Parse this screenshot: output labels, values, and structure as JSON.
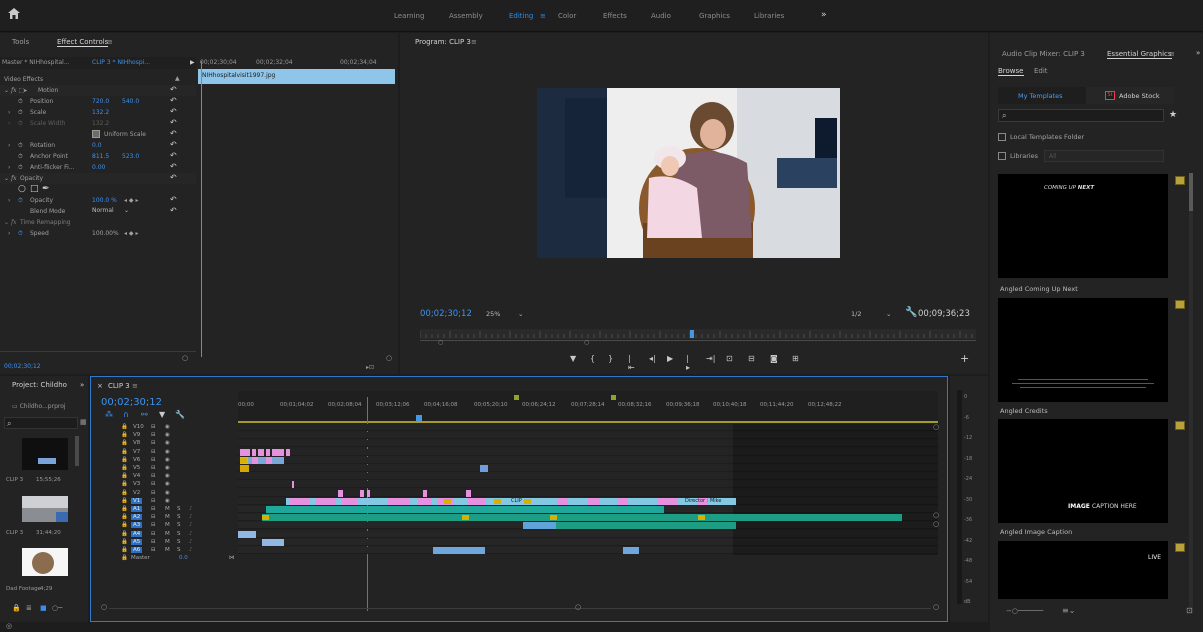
{
  "workspaces": [
    "Learning",
    "Assembly",
    "Editing",
    "Color",
    "Effects",
    "Audio",
    "Graphics",
    "Libraries"
  ],
  "workspace_menu_glyph": "≡",
  "more_glyph": "»",
  "effect_controls": {
    "tab_tools": "Tools",
    "tab_effect_controls": "Effect Controls",
    "menu_glyph": "≡",
    "master_label": "Master * NIHhospital...",
    "clip_label": "CLIP 3 * NIHhospi...",
    "time_a": "00;02;30;04",
    "time_b": "00;02;32;04",
    "time_c": "00;02;34;04",
    "clip_file": "NIHhospitalvisit1997.jpg",
    "video_effects": "Video Effects",
    "motion": "Motion",
    "position_label": "Position",
    "position_x": "720.0",
    "position_y": "540.0",
    "scale_label": "Scale",
    "scale_value": "132.2",
    "scale_width_label": "Scale Width",
    "scale_width_value": "132.2",
    "uniform_scale": "Uniform Scale",
    "rotation_label": "Rotation",
    "rotation_value": "0.0",
    "anchor_label": "Anchor Point",
    "anchor_x": "811.5",
    "anchor_y": "523.0",
    "antiflicker_label": "Anti-flicker Fi...",
    "antiflicker_value": "0.00",
    "opacity_group": "Opacity",
    "opacity_label": "Opacity",
    "opacity_value": "100.0 %",
    "blend_label": "Blend Mode",
    "blend_value": "Normal",
    "time_remap": "Time Remapping",
    "speed_label": "Speed",
    "speed_value": "100.00%",
    "current_time": "00;02;30;12"
  },
  "program": {
    "title": "Program: CLIP 3",
    "menu_glyph": "≡",
    "timecode": "00;02;30;12",
    "zoom": "25%",
    "resolution": "1/2",
    "duration": "00;09;36;23"
  },
  "essential_graphics": {
    "tab_audio_mixer": "Audio Clip Mixer: CLIP 3",
    "tab_essential": "Essential Graphics",
    "menu_glyph": "≡",
    "more_glyph": "»",
    "browse": "Browse",
    "edit": "Edit",
    "my_templates": "My Templates",
    "adobe_stock": "Adobe Stock",
    "stock_badge": "St",
    "local_templates": "Local Templates Folder",
    "libraries": "Libraries",
    "libraries_select": "All",
    "templates": [
      {
        "label": "Angled Coming Up Next",
        "preview_a": "COMING UP ",
        "preview_b": "NEXT"
      },
      {
        "label": "Angled Credits",
        "preview_a": "",
        "preview_b": ""
      },
      {
        "label": "Angled Image Caption",
        "preview_a": "IMAGE ",
        "preview_b": "CAPTION HERE"
      },
      {
        "label": "",
        "preview_a": "LIVE",
        "preview_b": ""
      }
    ]
  },
  "project": {
    "title": "Project: Childho",
    "more_glyph": "»",
    "file": "Childho...prproj",
    "items": [
      {
        "name": "CLIP 3",
        "duration": "15;55;26"
      },
      {
        "name": "CLIP 3",
        "duration": "31;44;20"
      },
      {
        "name": "Dad Footage",
        "duration": "4;29"
      }
    ]
  },
  "timeline": {
    "tab": "CLIP 3",
    "menu_glyph": "≡",
    "timecode": "00;02;30;12",
    "ruler": [
      "00;00",
      "00;01;04;02",
      "00;02;08;04",
      "00;03;12;06",
      "00;04;16;08",
      "00;05;20;10",
      "00;06;24;12",
      "00;07;28;14",
      "00;08;32;16",
      "00;09;36;18",
      "00;10;40;18",
      "00;11;44;20",
      "00;12;48;22"
    ],
    "video_tracks": [
      "V10",
      "V9",
      "V8",
      "V7",
      "V6",
      "V5",
      "V4",
      "V3",
      "V2",
      "V1"
    ],
    "audio_tracks": [
      "A1",
      "A2",
      "A3",
      "A4",
      "A5",
      "A6"
    ],
    "master_label": "Master",
    "master_value": "0.0",
    "clip_labels": [
      "CLIP",
      "Director : Mike"
    ],
    "meter_scale": [
      "0",
      "-6",
      "-12",
      "-18",
      "-24",
      "-30",
      "-36",
      "-42",
      "-48",
      "-54",
      "dB"
    ],
    "track_mute": "M",
    "track_solo": "S"
  },
  "colors": {
    "accent": "#2d8ceb",
    "video_clip": "#e691e0",
    "v1_clip": "#84c8e3",
    "audio_clip": "#1d9e84",
    "playhead": "#4796e4"
  }
}
